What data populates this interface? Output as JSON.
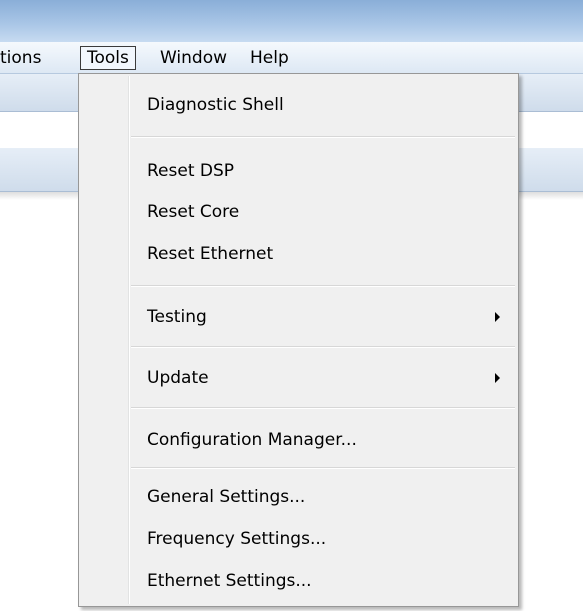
{
  "menubar": {
    "items": [
      {
        "label": "tions",
        "active": false
      },
      {
        "label": "Tools",
        "active": true
      },
      {
        "label": "Window",
        "active": false
      },
      {
        "label": "Help",
        "active": false
      }
    ]
  },
  "tools_menu": {
    "groups": [
      {
        "items": [
          {
            "label": "Diagnostic Shell",
            "has_submenu": false
          }
        ]
      },
      {
        "items": [
          {
            "label": "Reset DSP",
            "has_submenu": false
          },
          {
            "label": "Reset Core",
            "has_submenu": false
          },
          {
            "label": "Reset Ethernet",
            "has_submenu": false
          }
        ]
      },
      {
        "items": [
          {
            "label": "Testing",
            "has_submenu": true
          }
        ]
      },
      {
        "items": [
          {
            "label": "Update",
            "has_submenu": true
          }
        ]
      },
      {
        "items": [
          {
            "label": "Configuration Manager...",
            "has_submenu": false
          }
        ]
      },
      {
        "items": [
          {
            "label": "General Settings...",
            "has_submenu": false
          },
          {
            "label": "Frequency Settings...",
            "has_submenu": false
          },
          {
            "label": "Ethernet Settings...",
            "has_submenu": false
          }
        ]
      }
    ]
  },
  "colors": {
    "menu_background": "#f0f0f0",
    "menu_border": "#979797",
    "active_menu_border": "#3b3b3b",
    "titlebar": "#a8c5e6"
  }
}
